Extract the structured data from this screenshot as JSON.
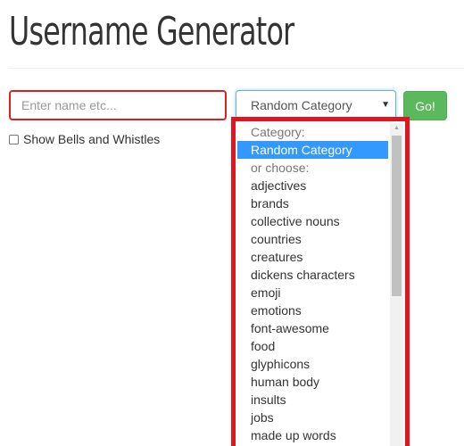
{
  "header": {
    "title": "Username Generator"
  },
  "form": {
    "name_placeholder": "Enter name etc...",
    "category_selected": "Random Category",
    "go_label": "Go!",
    "show_bells_label": "Show Bells and Whistles"
  },
  "dropdown": {
    "items": [
      {
        "label": "Category:",
        "kind": "group"
      },
      {
        "label": "Random Category",
        "kind": "selected"
      },
      {
        "label": "or choose:",
        "kind": "group"
      },
      {
        "label": "adjectives",
        "kind": "option"
      },
      {
        "label": "brands",
        "kind": "option"
      },
      {
        "label": "collective nouns",
        "kind": "option"
      },
      {
        "label": "countries",
        "kind": "option"
      },
      {
        "label": "creatures",
        "kind": "option"
      },
      {
        "label": "dickens characters",
        "kind": "option"
      },
      {
        "label": "emoji",
        "kind": "option"
      },
      {
        "label": "emotions",
        "kind": "option"
      },
      {
        "label": "font-awesome",
        "kind": "option"
      },
      {
        "label": "food",
        "kind": "option"
      },
      {
        "label": "glyphicons",
        "kind": "option"
      },
      {
        "label": "human body",
        "kind": "option"
      },
      {
        "label": "insults",
        "kind": "option"
      },
      {
        "label": "jobs",
        "kind": "option"
      },
      {
        "label": "made up words",
        "kind": "option"
      }
    ]
  },
  "colors": {
    "accent_highlight": "#e3141f",
    "selected_option": "#3399ff",
    "go_button": "#5cb85c",
    "input_border": "#dc2020"
  },
  "icons": {
    "select_caret": "chevron-down-icon",
    "scroll_up": "scroll-up-arrow-icon"
  }
}
